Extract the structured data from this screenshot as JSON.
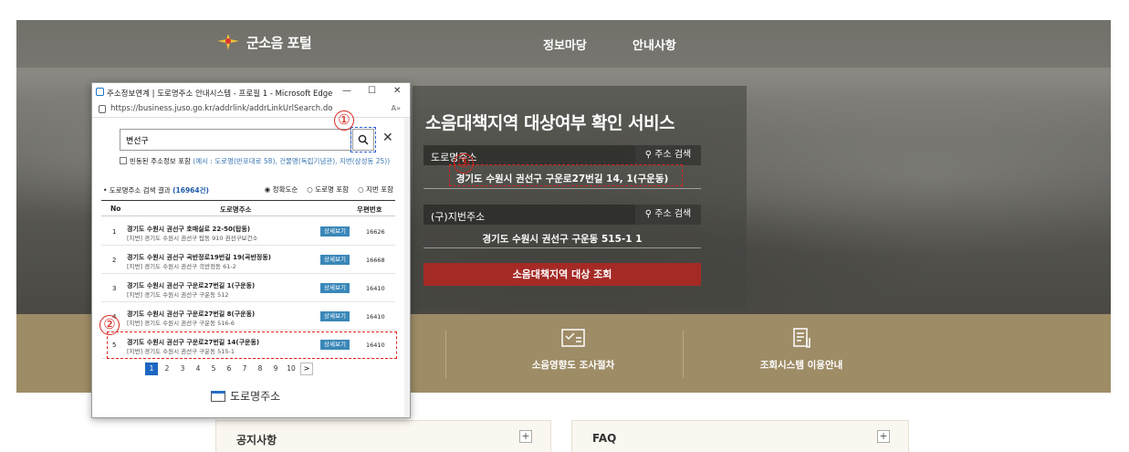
{
  "site": {
    "logo_text": "군소음 포털",
    "nav": [
      "정보마당",
      "안내사항"
    ],
    "service_title": "소음대책지역 대상여부 확인 서비스",
    "road_label": "도로명주소",
    "road_search": "주소 검색",
    "road_result": "경기도 수원시 권선구 구운로27번길 14, 1(구운동)",
    "lot_label": "(구)지번주소",
    "lot_search": "주소 검색",
    "lot_result": "경기도 수원시 권선구 구운동 515-1 1",
    "query_button": "소음대책지역 대상 조회",
    "band_items": [
      "소음영향도 조사절차",
      "조회시스템 이용안내"
    ],
    "boards": [
      "공지사항",
      "FAQ"
    ],
    "plus": "+"
  },
  "popup": {
    "window_title": "주소정보연계 | 도로명주소 안내시스템 - 프로필 1 - Microsoft Edge",
    "url": "https://business.juso.go.kr/addrlink/addrLinkUrlSearch.do",
    "search_value": "변선구",
    "option_label": "빈동된 주소정보 포함",
    "option_example": "(예시 : 도로명(반포대로 58), 건물명(독립기념관), 지번(삼성동 25))",
    "result_label": "• 도로명주소 검색 결과",
    "result_count": "(16964건)",
    "sort_options": [
      "◉ 정확도순",
      "○ 도로명 포함",
      "○ 지번 포함"
    ],
    "columns": [
      "No",
      "도로명주소",
      "우편번호"
    ],
    "rows": [
      {
        "no": "1",
        "road": "경기도 수원시 권선구 호매실로 22-50(탑동)",
        "lot": "[지번] 경기도 수원시 권선구 탑동 910 권선구보건소",
        "detail": "상세보기",
        "zip": "16626"
      },
      {
        "no": "2",
        "road": "경기도 수원시 권선구 곡반정로19번길 19(곡반정동)",
        "lot": "[지번] 경기도 수원시 권선구 곡반정동 61-2",
        "detail": "상세보기",
        "zip": "16668"
      },
      {
        "no": "3",
        "road": "경기도 수원시 권선구 구운로27번길 1(구운동)",
        "lot": "[지번] 경기도 수원시 권선구 구운동 512",
        "detail": "상세보기",
        "zip": "16410"
      },
      {
        "no": "4",
        "road": "경기도 수원시 권선구 구운로27번길 8(구운동)",
        "lot": "[지번] 경기도 수원시 권선구 구운동 516-6",
        "detail": "상세보기",
        "zip": "16410"
      },
      {
        "no": "5",
        "road": "경기도 수원시 권선구 구운로27번길 14(구운동)",
        "lot": "[지번] 경기도 수원시 권선구 구운동 515-1",
        "detail": "상세보기",
        "zip": "16410"
      }
    ],
    "pages": [
      "1",
      "2",
      "3",
      "4",
      "5",
      "6",
      "7",
      "8",
      "9",
      "10"
    ],
    "next": ">",
    "brand": "도로명주소"
  },
  "annotations": [
    "①",
    "②",
    "③"
  ]
}
